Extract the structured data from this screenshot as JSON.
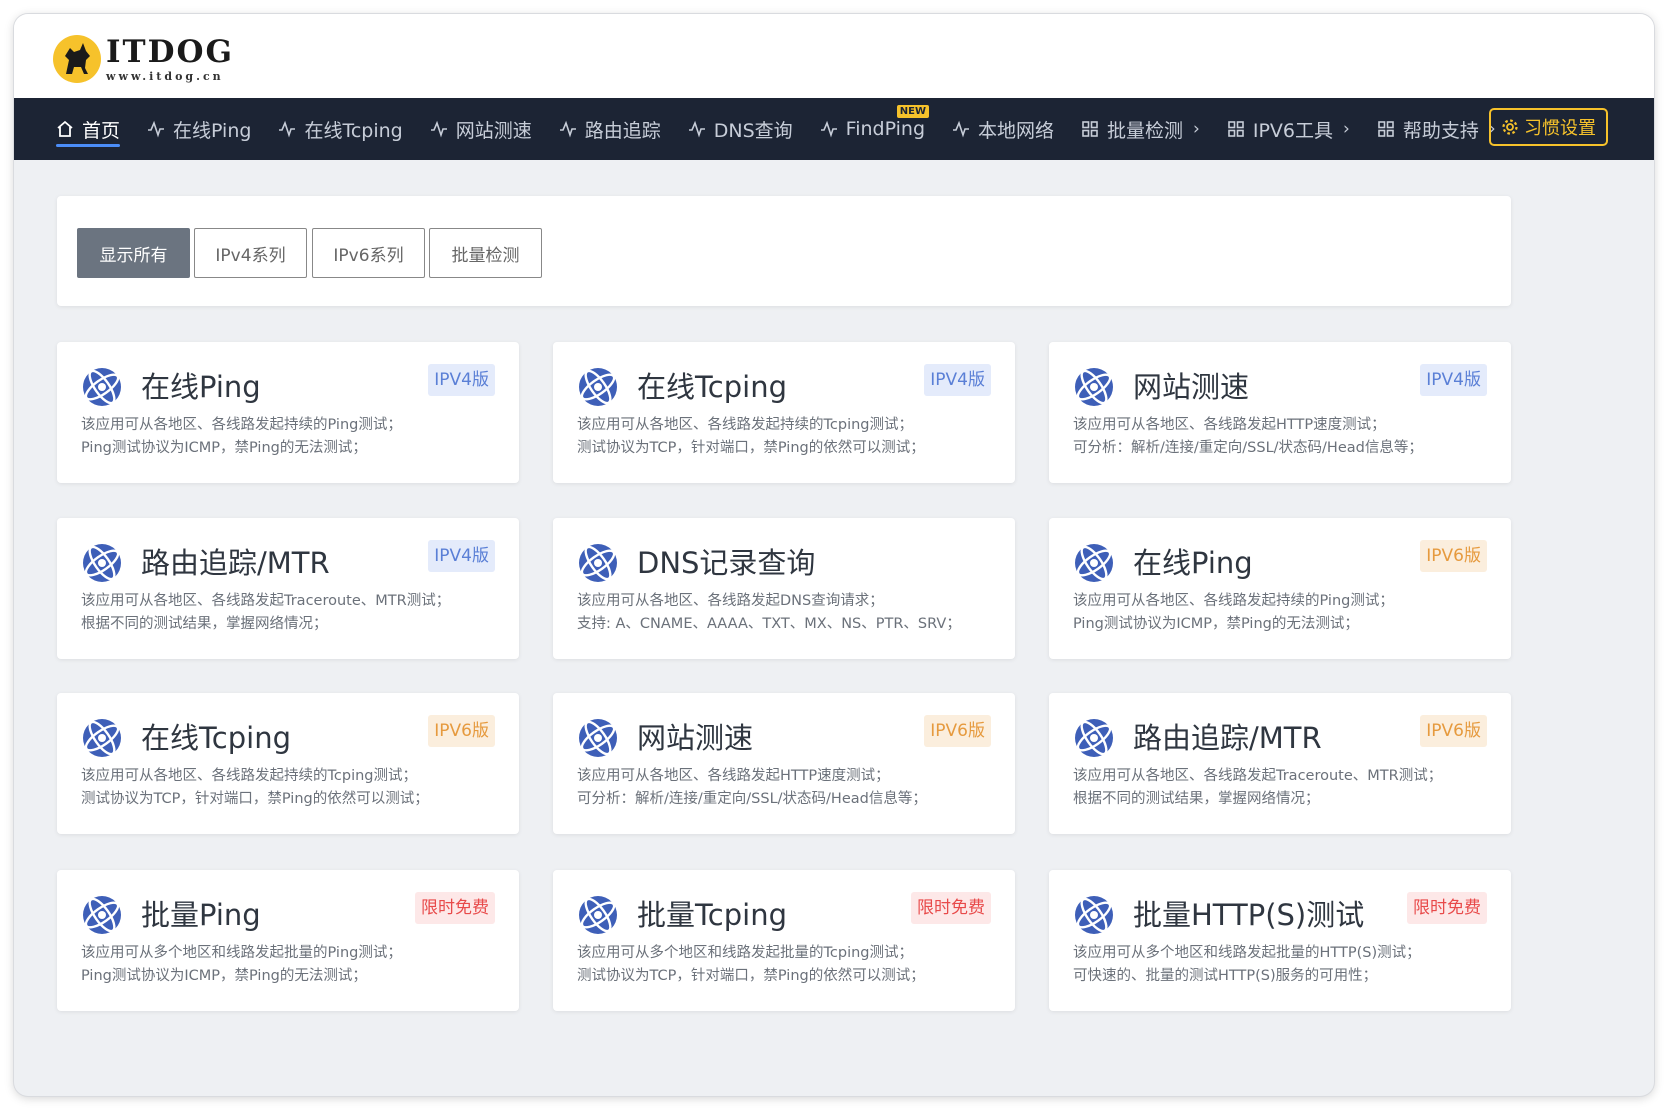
{
  "brand": {
    "title": "ITDOG",
    "subtitle": "www.itdog.cn"
  },
  "nav": {
    "items": [
      {
        "label": "首页",
        "icon": "home-icon",
        "active": true
      },
      {
        "label": "在线Ping",
        "icon": "pulse-icon"
      },
      {
        "label": "在线Tcping",
        "icon": "pulse-icon"
      },
      {
        "label": "网站测速",
        "icon": "pulse-icon"
      },
      {
        "label": "路由追踪",
        "icon": "pulse-icon"
      },
      {
        "label": "DNS查询",
        "icon": "pulse-icon"
      },
      {
        "label": "FindPing",
        "icon": "pulse-icon",
        "badge": "NEW"
      },
      {
        "label": "本地网络",
        "icon": "pulse-icon"
      },
      {
        "label": "批量检测",
        "icon": "grid-icon",
        "dropdown": true
      },
      {
        "label": "IPV6工具",
        "icon": "grid-icon",
        "dropdown": true
      },
      {
        "label": "帮助支持",
        "icon": "grid-icon",
        "dropdown": true
      }
    ],
    "habit_button": "习惯设置"
  },
  "filters": [
    "显示所有",
    "IPv4系列",
    "IPv6系列",
    "批量检测"
  ],
  "cards": [
    {
      "title": "在线Ping",
      "tag": "IPV4版",
      "tag_type": "ipv4",
      "desc1": "该应用可从各地区、各线路发起持续的Ping测试；",
      "desc2": "Ping测试协议为ICMP，禁Ping的无法测试；"
    },
    {
      "title": "在线Tcping",
      "tag": "IPV4版",
      "tag_type": "ipv4",
      "desc1": "该应用可从各地区、各线路发起持续的Tcping测试；",
      "desc2": "测试协议为TCP，针对端口，禁Ping的依然可以测试；"
    },
    {
      "title": "网站测速",
      "tag": "IPV4版",
      "tag_type": "ipv4",
      "desc1": "该应用可从各地区、各线路发起HTTP速度测试；",
      "desc2": "可分析：解析/连接/重定向/SSL/状态码/Head信息等；"
    },
    {
      "title": "路由追踪/MTR",
      "tag": "IPV4版",
      "tag_type": "ipv4",
      "desc1": "该应用可从各地区、各线路发起Traceroute、MTR测试；",
      "desc2": "根据不同的测试结果，掌握网络情况；"
    },
    {
      "title": "DNS记录查询",
      "tag": "",
      "tag_type": "",
      "desc1": "该应用可从各地区、各线路发起DNS查询请求；",
      "desc2": "支持: A、CNAME、AAAA、TXT、MX、NS、PTR、SRV；"
    },
    {
      "title": "在线Ping",
      "tag": "IPV6版",
      "tag_type": "ipv6",
      "desc1": "该应用可从各地区、各线路发起持续的Ping测试；",
      "desc2": "Ping测试协议为ICMP，禁Ping的无法测试；"
    },
    {
      "title": "在线Tcping",
      "tag": "IPV6版",
      "tag_type": "ipv6",
      "desc1": "该应用可从各地区、各线路发起持续的Tcping测试；",
      "desc2": "测试协议为TCP，针对端口，禁Ping的依然可以测试；"
    },
    {
      "title": "网站测速",
      "tag": "IPV6版",
      "tag_type": "ipv6",
      "desc1": "该应用可从各地区、各线路发起HTTP速度测试；",
      "desc2": "可分析：解析/连接/重定向/SSL/状态码/Head信息等；"
    },
    {
      "title": "路由追踪/MTR",
      "tag": "IPV6版",
      "tag_type": "ipv6",
      "desc1": "该应用可从各地区、各线路发起Traceroute、MTR测试；",
      "desc2": "根据不同的测试结果，掌握网络情况；"
    },
    {
      "title": "批量Ping",
      "tag": "限时免费",
      "tag_type": "free",
      "desc1": "该应用可从多个地区和线路发起批量的Ping测试；",
      "desc2": "Ping测试协议为ICMP，禁Ping的无法测试；"
    },
    {
      "title": "批量Tcping",
      "tag": "限时免费",
      "tag_type": "free",
      "desc1": "该应用可从多个地区和线路发起批量的Tcping测试；",
      "desc2": "测试协议为TCP，针对端口，禁Ping的依然可以测试；"
    },
    {
      "title": "批量HTTP(S)测试",
      "tag": "限时免费",
      "tag_type": "free",
      "desc1": "该应用可从多个地区和线路发起批量的HTTP(S)测试；",
      "desc2": "可快速的、批量的测试HTTP(S)服务的可用性；"
    }
  ],
  "colors": {
    "nav_bg": "#1c2434",
    "accent_yellow": "#f6c22b",
    "card_icon": "#3e5fb8"
  }
}
